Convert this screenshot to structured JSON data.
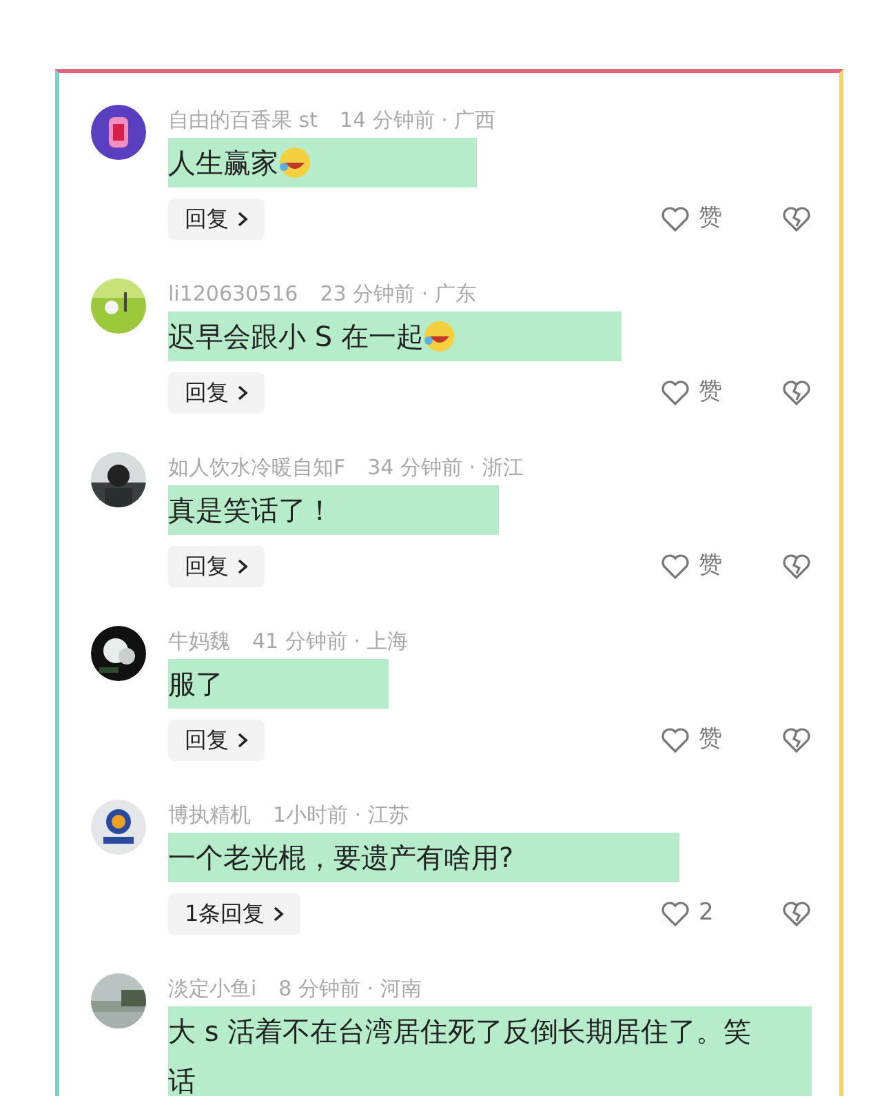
{
  "comments": [
    {
      "user": "自由的百香果 st",
      "when_where": "14 分钟前 · 广西",
      "text": "人生赢家",
      "emoji": true,
      "reply_label": "回复",
      "like_label": "赞"
    },
    {
      "user": "li120630516",
      "when_where": "23 分钟前 · 广东",
      "text": "迟早会跟小 S 在一起",
      "emoji": true,
      "reply_label": "回复",
      "like_label": "赞"
    },
    {
      "user": "如人饮水冷暖自知F",
      "when_where": "34 分钟前 · 浙江",
      "text": "真是笑话了！",
      "reply_label": "回复",
      "like_label": "赞"
    },
    {
      "user": "牛妈魏",
      "when_where": "41 分钟前 · 上海",
      "text": "服了",
      "reply_label": "回复",
      "like_label": "赞"
    },
    {
      "user": "博执精机",
      "when_where": "1小时前 · 江苏",
      "text": "一个老光棍，要遗产有啥用?",
      "reply_label": "1条回复",
      "like_label": "2"
    },
    {
      "user": "淡定小鱼i",
      "when_where": "8 分钟前 · 河南",
      "text": "大 s 活着不在台湾居住死了反倒长期居住了。笑话"
    }
  ]
}
